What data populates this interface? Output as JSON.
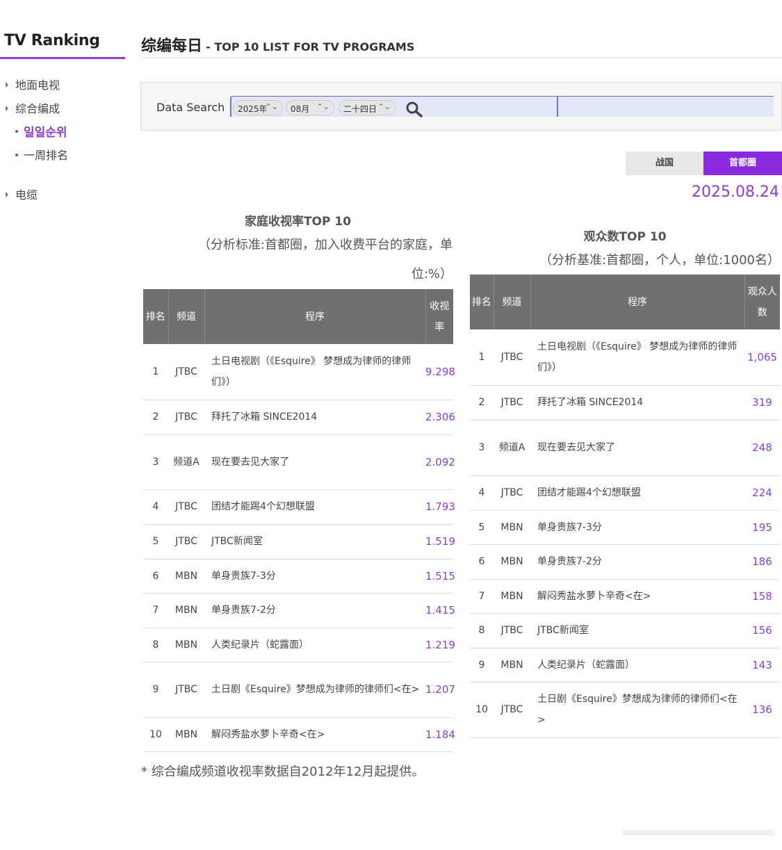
{
  "sidebar": {
    "brand": "TV Ranking",
    "items": [
      {
        "label": "地面电视"
      },
      {
        "label": "综合编成"
      },
      {
        "label": "电缆"
      }
    ],
    "subitems": [
      {
        "label": "일일순위",
        "active": true
      },
      {
        "label": "一周排名",
        "active": false
      }
    ]
  },
  "header": {
    "title": "综编每日",
    "subtitle": "- TOP 10 LIST FOR TV PROGRAMS"
  },
  "search": {
    "label": "Data Search",
    "year": "2025年",
    "month": "08月",
    "day": "二十四日"
  },
  "region": {
    "national": "战国",
    "capital": "首都圈"
  },
  "date": "2025.08.24",
  "household": {
    "title": "家庭收视率TOP 10",
    "subtitle_line1": "（分析标准:首都圈，加入收费平台的家庭，单",
    "subtitle_line2": "位:%）",
    "headers": {
      "rank": "排名",
      "channel": "频道",
      "program": "程序",
      "value_l1": "收视",
      "value_l2": "率"
    },
    "rows": [
      {
        "rank": "1",
        "channel": "JTBC",
        "program": "土日电视剧（《Esquire》 梦想成为律师的律师们》）",
        "value": "9.298"
      },
      {
        "rank": "2",
        "channel": "JTBC",
        "program": "拜托了冰箱 SINCE2014",
        "value": "2.306"
      },
      {
        "rank": "3",
        "channel": "频道A",
        "program": "现在要去见大家了",
        "value": "2.092"
      },
      {
        "rank": "4",
        "channel": "JTBC",
        "program": "团结才能踢4个幻想联盟",
        "value": "1.793"
      },
      {
        "rank": "5",
        "channel": "JTBC",
        "program": "JTBC新闻室",
        "value": "1.519"
      },
      {
        "rank": "6",
        "channel": "MBN",
        "program": "单身贵族7-3分",
        "value": "1.515"
      },
      {
        "rank": "7",
        "channel": "MBN",
        "program": "单身贵族7-2分",
        "value": "1.415"
      },
      {
        "rank": "8",
        "channel": "MBN",
        "program": "人类纪录片（蛇露面）",
        "value": "1.219"
      },
      {
        "rank": "9",
        "channel": "JTBC",
        "program": "土日剧《Esquire》梦想成为律师的律师们<在>",
        "value": "1.207"
      },
      {
        "rank": "10",
        "channel": "MBN",
        "program": "解闷秀盐水萝卜辛奇<在>",
        "value": "1.184"
      }
    ]
  },
  "viewers": {
    "title": "观众数TOP 10",
    "subtitle": "（分析基准:首都圈，个人，单位:1000名）",
    "headers": {
      "rank": "排名",
      "channel": "频道",
      "program": "程序",
      "value_l1": "观众人",
      "value_l2": "数"
    },
    "rows": [
      {
        "rank": "1",
        "channel": "JTBC",
        "program": "土日电视剧（《Esquire》 梦想成为律师的律师们》）",
        "value": "1,065"
      },
      {
        "rank": "2",
        "channel": "JTBC",
        "program": "拜托了冰箱 SINCE2014",
        "value": "319"
      },
      {
        "rank": "3",
        "channel": "频道A",
        "program": "现在要去见大家了",
        "value": "248"
      },
      {
        "rank": "4",
        "channel": "JTBC",
        "program": "团结才能踢4个幻想联盟",
        "value": "224"
      },
      {
        "rank": "5",
        "channel": "MBN",
        "program": "单身贵族7-3分",
        "value": "195"
      },
      {
        "rank": "6",
        "channel": "MBN",
        "program": "单身贵族7-2分",
        "value": "186"
      },
      {
        "rank": "7",
        "channel": "MBN",
        "program": "解闷秀盐水萝卜辛奇<在>",
        "value": "158"
      },
      {
        "rank": "8",
        "channel": "JTBC",
        "program": "JTBC新闻室",
        "value": "156"
      },
      {
        "rank": "9",
        "channel": "MBN",
        "program": "人类纪录片（蛇露面）",
        "value": "143"
      },
      {
        "rank": "10",
        "channel": "JTBC",
        "program": "土日剧《Esquire》梦想成为律师的律师们<在>",
        "value": "136"
      }
    ]
  },
  "footnote": "* 综合编成频道收视率数据自2012年12月起提供。",
  "colors": {
    "accent": "#8a3fd1",
    "header_bg": "#707070",
    "search_bg": "#e3e8f8"
  }
}
